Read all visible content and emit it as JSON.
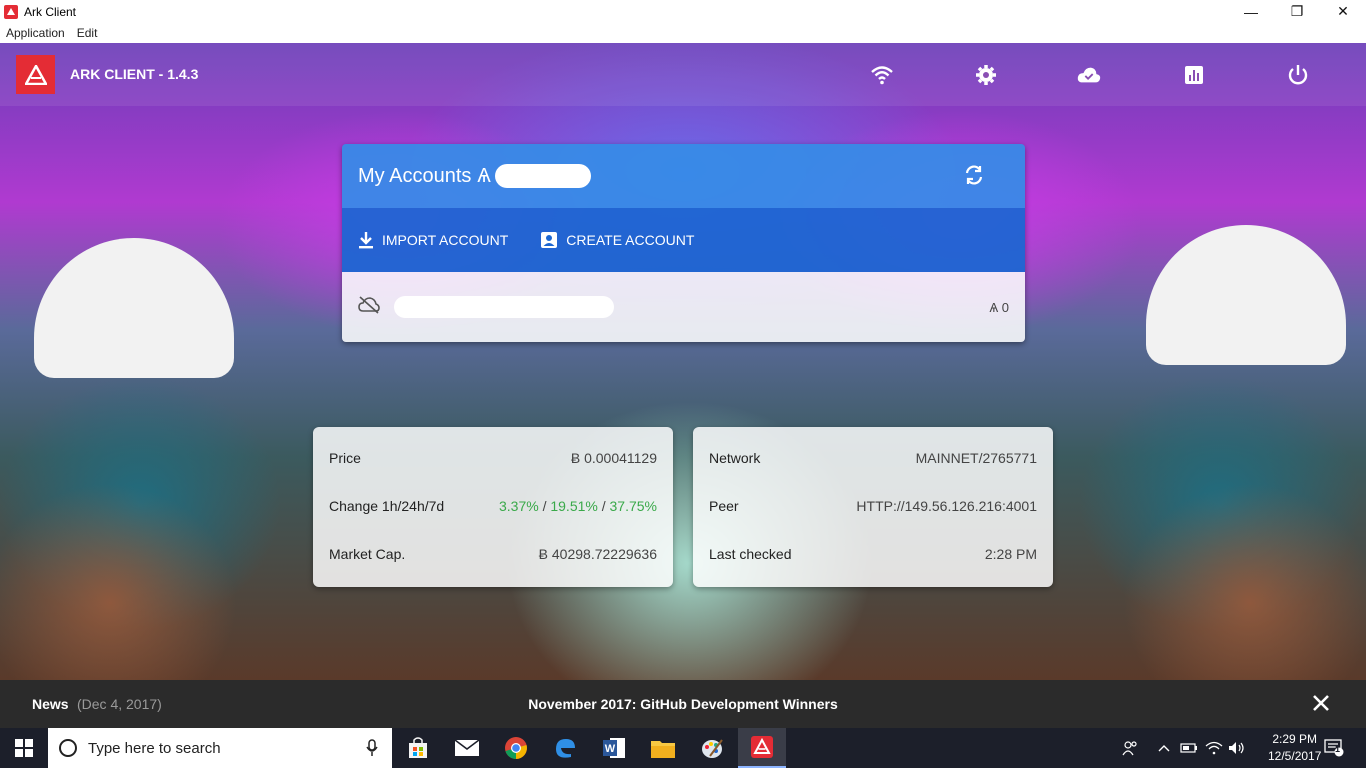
{
  "window": {
    "title": "Ark Client",
    "controls": {
      "minimize": "—",
      "restore": "❐",
      "close": "✕"
    }
  },
  "menubar": {
    "items": [
      "Application",
      "Edit"
    ]
  },
  "header": {
    "title": "ARK CLIENT - 1.4.3",
    "icons": [
      "wifi-icon",
      "gear-icon",
      "cloud-icon",
      "chart-icon",
      "power-icon"
    ]
  },
  "accounts": {
    "title": "My Accounts",
    "title_symbol": "Ѧ",
    "import_label": "IMPORT ACCOUNT",
    "create_label": "CREATE ACCOUNT",
    "account_balance": "Ѧ 0"
  },
  "market": {
    "price_label": "Price",
    "price_value": "Ƀ 0.00041129",
    "change_label": "Change 1h/24h/7d",
    "change_1h": "3.37%",
    "change_24h": "19.51%",
    "change_7d": "37.75%",
    "sep": " / ",
    "cap_label": "Market Cap.",
    "cap_value": "Ƀ 40298.72229636"
  },
  "network": {
    "network_label": "Network",
    "network_value": "MAINNET/2765771",
    "peer_label": "Peer",
    "peer_value": "HTTP://149.56.126.216:4001",
    "checked_label": "Last checked",
    "checked_value": "2:28 PM"
  },
  "news": {
    "label": "News",
    "date": "(Dec 4, 2017)",
    "headline": "November 2017: GitHub Development Winners",
    "close": "✕"
  },
  "taskbar": {
    "search_placeholder": "Type here to search",
    "time": "2:29 PM",
    "date": "12/5/2017",
    "notification_count": "1"
  },
  "colors": {
    "ark_red": "#e42c35",
    "card_blue": "#358ce7",
    "card_dark_blue": "#1b66d2",
    "positive_green": "#3aa94a"
  }
}
